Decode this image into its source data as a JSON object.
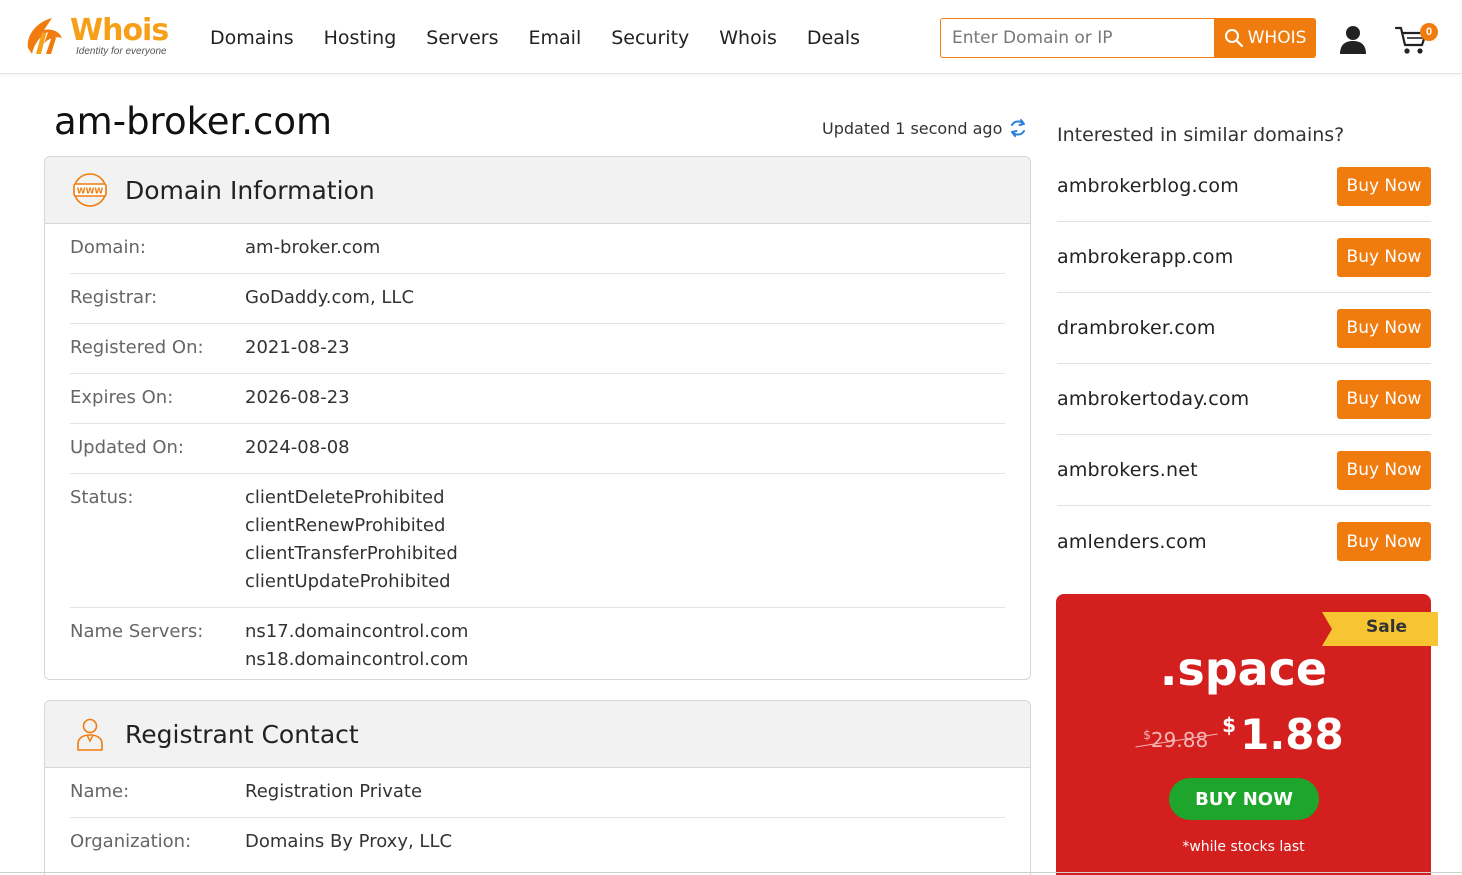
{
  "header": {
    "logo_word": "Whois",
    "logo_tagline": "Identity for everyone",
    "nav": [
      "Domains",
      "Hosting",
      "Servers",
      "Email",
      "Security",
      "Whois",
      "Deals"
    ],
    "search_placeholder": "Enter Domain or IP",
    "search_button": "WHOIS",
    "cart_count": "0",
    "accent_color": "#f07c0f"
  },
  "page": {
    "title": "am-broker.com",
    "updated": "Updated 1 second ago"
  },
  "domain_info": {
    "title": "Domain Information",
    "rows": [
      {
        "label": "Domain:",
        "values": [
          "am-broker.com"
        ]
      },
      {
        "label": "Registrar:",
        "values": [
          "GoDaddy.com, LLC"
        ]
      },
      {
        "label": "Registered On:",
        "values": [
          "2021-08-23"
        ]
      },
      {
        "label": "Expires On:",
        "values": [
          "2026-08-23"
        ]
      },
      {
        "label": "Updated On:",
        "values": [
          "2024-08-08"
        ]
      },
      {
        "label": "Status:",
        "values": [
          "clientDeleteProhibited",
          "clientRenewProhibited",
          "clientTransferProhibited",
          "clientUpdateProhibited"
        ]
      },
      {
        "label": "Name Servers:",
        "values": [
          "ns17.domaincontrol.com",
          "ns18.domaincontrol.com"
        ]
      }
    ]
  },
  "registrant": {
    "title": "Registrant Contact",
    "rows": [
      {
        "label": "Name:",
        "values": [
          "Registration Private"
        ]
      },
      {
        "label": "Organization:",
        "values": [
          "Domains By Proxy, LLC"
        ]
      }
    ]
  },
  "similar": {
    "title": "Interested in similar domains?",
    "button_label": "Buy Now",
    "items": [
      "ambrokerblog.com",
      "ambrokerapp.com",
      "drambroker.com",
      "ambrokertoday.com",
      "ambrokers.net",
      "amlenders.com"
    ]
  },
  "promo": {
    "ribbon": "Sale",
    "tld": ".space",
    "currency": "$",
    "old_price": "29.88",
    "new_price": "1.88",
    "button": "BUY NOW",
    "note": "*while stocks last",
    "bg_color": "#d41f1f",
    "ribbon_color": "#f7c531",
    "button_color": "#1ea52b"
  }
}
